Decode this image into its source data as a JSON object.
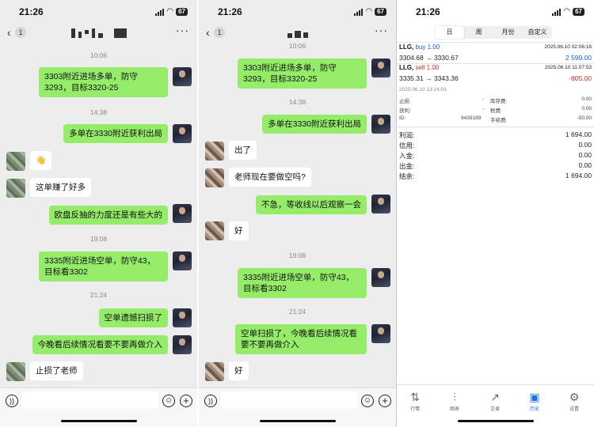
{
  "status": {
    "time": "21:26",
    "battery": "67"
  },
  "chat1": {
    "badge": "1",
    "more": "···",
    "timestamps": [
      "10:06",
      "14:38",
      "19:08",
      "21:24"
    ],
    "messages": [
      "3303附近进场多单，防守3293，目标3320-25",
      "多单在3330附近获利出局",
      "👋",
      "这单赚了好多",
      "欧盘反抽的力度还是有些大的",
      "3335附近进场空单，防守43，目标看3302",
      "空单遗憾扫损了",
      "今晚看后续情况看要不要再做介入",
      "止损了老师"
    ]
  },
  "chat2": {
    "badge": "1",
    "more": "···",
    "timestamps": [
      "10:06",
      "14:38",
      "19:08",
      "21:24"
    ],
    "messages": [
      "3303附近进场多单，防守3293，目标3320-25",
      "多单在3330附近获利出局",
      "出了",
      "老师现在要做空吗?",
      "不急，等收线以后观察一会",
      "好",
      "3335附近进场空单，防守43，目标看3302",
      "空单扫损了，今晚看后续情况看要不要再做介入",
      "好"
    ]
  },
  "mt": {
    "tabs": [
      "日",
      "周",
      "月份",
      "自定义"
    ],
    "deals": [
      {
        "symbol": "LLG,",
        "side": "buy 1.00",
        "date": "2025.06.10 02:06:16",
        "price": "3304.68 → 3330.67",
        "profit": "2 599.00",
        "color": "#1a5fd6"
      },
      {
        "symbol": "LLG,",
        "side": "sell 1.00",
        "date": "2025.06.10 11:07:53",
        "price": "3335.31 → 3343.36",
        "profit": "-805.00",
        "color": "#d62b2b"
      }
    ],
    "detail_time": "2025.06.10 13:24:03",
    "details": [
      {
        "l1": "止损:",
        "v1": "-",
        "l2": "库存费:",
        "v2": "0.00"
      },
      {
        "l1": "获利:",
        "v1": "-",
        "l2": "税费:",
        "v2": "0.00"
      },
      {
        "l1": "ID:",
        "v1": "9439189",
        "l2": "手续费:",
        "v2": "-50.00"
      }
    ],
    "summary": [
      {
        "label": "利润:",
        "value": "1 694.00"
      },
      {
        "label": "信用:",
        "value": "0.00"
      },
      {
        "label": "入金:",
        "value": "0.00"
      },
      {
        "label": "出金:",
        "value": "0.00"
      },
      {
        "label": "结余:",
        "value": "1 694.00"
      }
    ],
    "bottom_tabs": [
      {
        "label": "行情",
        "icon": "quotes-icon"
      },
      {
        "label": "图表",
        "icon": "chart-icon"
      },
      {
        "label": "交易",
        "icon": "trade-icon"
      },
      {
        "label": "历史",
        "icon": "history-icon"
      },
      {
        "label": "设置",
        "icon": "settings-icon"
      }
    ]
  }
}
